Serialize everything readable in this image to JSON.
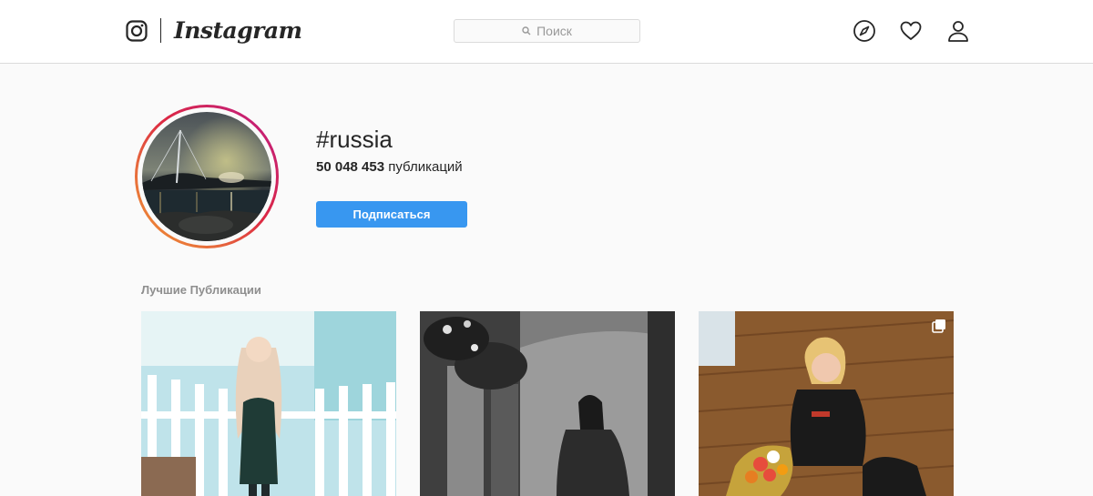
{
  "header": {
    "brand": "Instagram",
    "search_placeholder": "Поиск",
    "icons": [
      "instagram-glyph-icon",
      "compass-icon",
      "heart-icon",
      "user-icon"
    ]
  },
  "hashtag": {
    "name": "#russia",
    "posts_count": "50 048 453",
    "posts_label": "публикаций",
    "follow_label": "Подписаться"
  },
  "top_posts": {
    "label": "Лучшие Публикации",
    "items": [
      {
        "alt": "post-woman-cafe",
        "multi": false
      },
      {
        "alt": "post-woman-bw",
        "multi": false
      },
      {
        "alt": "post-woman-flowers",
        "multi": true
      }
    ]
  },
  "colors": {
    "accent": "#3897f0",
    "ring_start": "#f09433",
    "ring_end": "#bc1888",
    "background": "#fafafa",
    "border": "#dbdbdb"
  }
}
